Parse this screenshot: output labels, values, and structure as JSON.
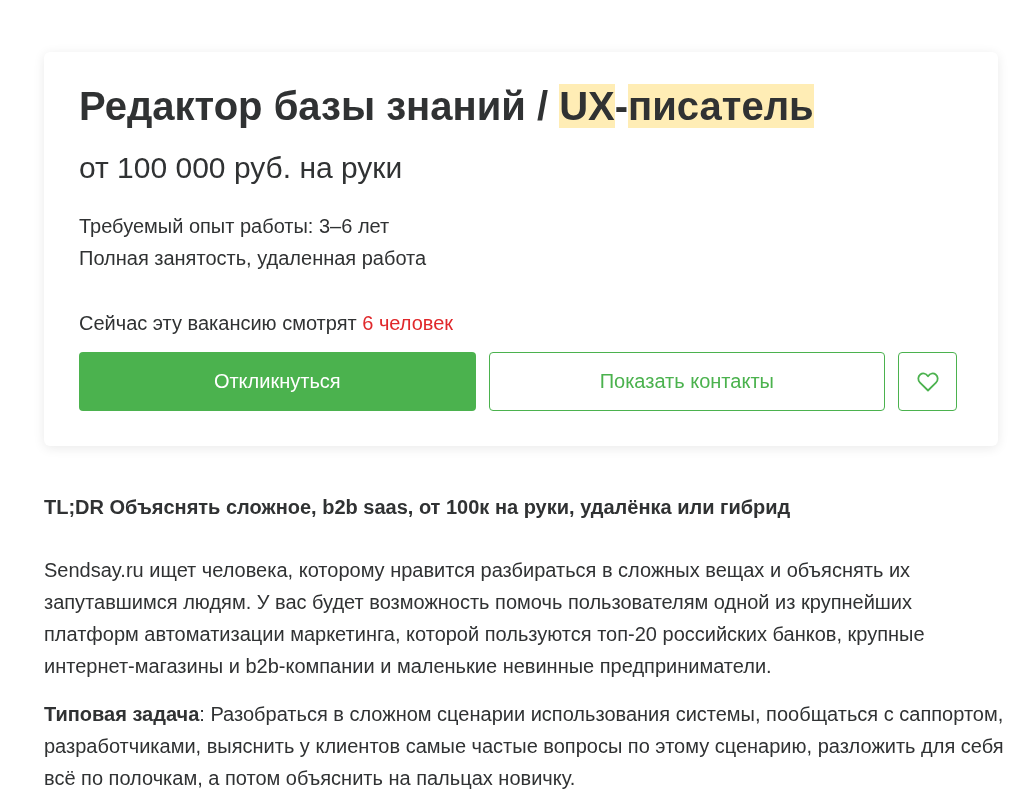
{
  "vacancy": {
    "title": [
      {
        "text": "Редактор базы знаний / ",
        "highlighted": false
      },
      {
        "text": "UX",
        "highlighted": true
      },
      {
        "text": "-",
        "highlighted": false
      },
      {
        "text": "писатель",
        "highlighted": true
      }
    ],
    "salary": "от 100 000 руб. на руки",
    "details": [
      "Требуемый опыт работы: 3–6 лет",
      "Полная занятость, удаленная работа"
    ],
    "viewers": {
      "text": "Сейчас эту вакансию смотрят",
      "count": "6 человек"
    },
    "buttons": [
      {
        "kind": "primary",
        "label": "Откликнуться"
      },
      {
        "kind": "outline",
        "label": "Показать контакты"
      },
      {
        "kind": "favorite"
      }
    ]
  },
  "description": {
    "summary": "TL;DR Объяснять сложное, b2b saas, от 100к на руки, удалёнка или гибрид",
    "paragraphs": [
      "Sendsay.ru ищет человека, которому нравится разбираться в сложных вещах и объяснять их запутавшимся людям. У вас будет возможность помочь пользователям одной из крупнейших платформ автоматизации маркетинга, которой пользуются топ-20 российских банков, крупные интернет-магазины и b2b-компании и маленькие невинные предприниматели.",
      "**Типовая задача**: Разобраться в сложном сценарии использования системы, пообщаться с саппортом, разработчиками, выяснить у клиентов самые частые вопросы по этому сценарию, разложить для себя всё по полочкам, а потом объяснить на пальцах новичку."
    ]
  }
}
